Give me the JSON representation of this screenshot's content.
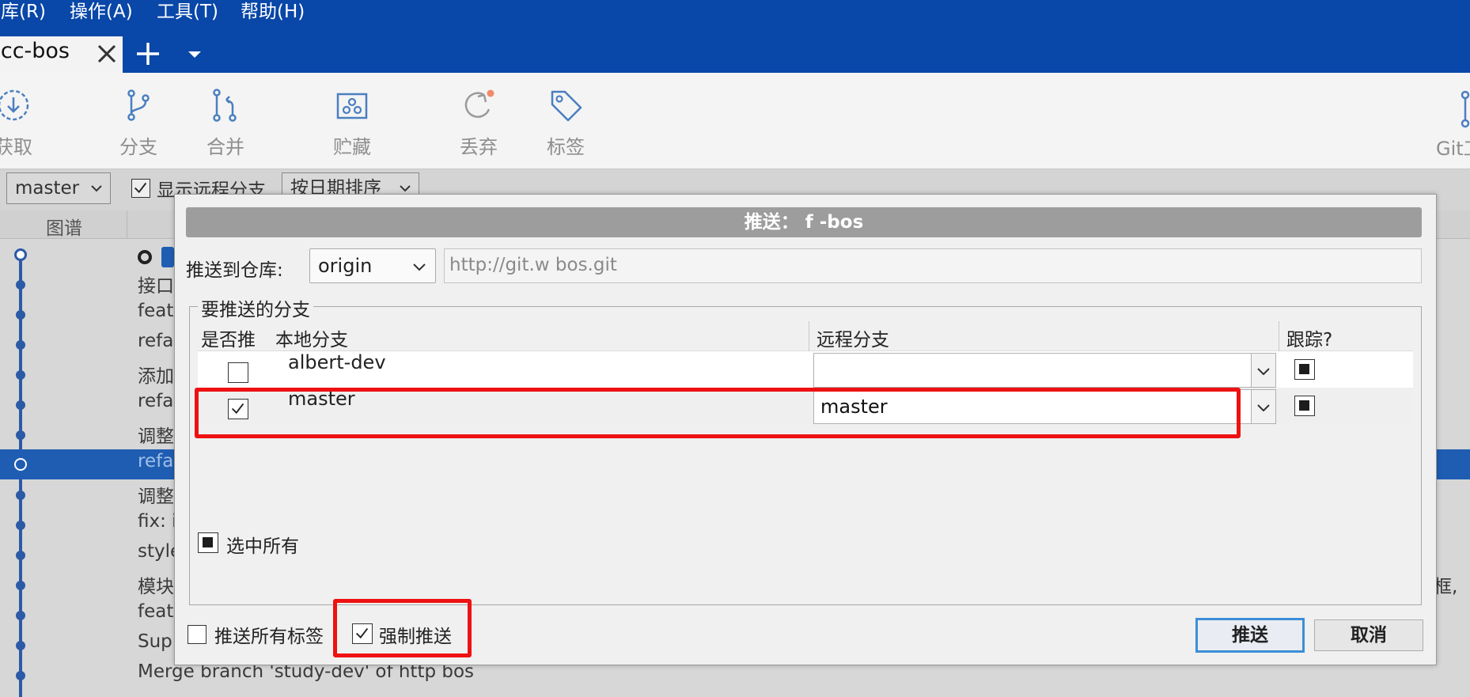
{
  "menubar": {
    "items": [
      {
        "label": "仓库(R)"
      },
      {
        "label": "操作(A)"
      },
      {
        "label": "工具(T)"
      },
      {
        "label": "帮助(H)"
      }
    ]
  },
  "tabs": {
    "active_label": "ccc-bos"
  },
  "toolbar": {
    "items": [
      {
        "label": "获取",
        "icon": "fetch-icon"
      },
      {
        "label": "分支",
        "icon": "branch-icon"
      },
      {
        "label": "合并",
        "icon": "merge-icon"
      },
      {
        "label": "贮藏",
        "icon": "stash-icon"
      },
      {
        "label": "丢弃",
        "icon": "discard-icon"
      },
      {
        "label": "标签",
        "icon": "tag-icon"
      }
    ],
    "right_label": "Git工"
  },
  "filters": {
    "branch_select": "master",
    "show_remote_label": "显示远程分支",
    "show_remote_checked": true,
    "sort_select": "按日期排序"
  },
  "history": {
    "graph_header": "图谱",
    "rows": [
      {
        "message": ""
      },
      {
        "message": "接口"
      },
      {
        "message": "feat"
      },
      {
        "message": "refa"
      },
      {
        "message": "添加"
      },
      {
        "message": "refa"
      },
      {
        "message": "调整"
      },
      {
        "message": "refa",
        "selected": true
      },
      {
        "message": "调整"
      },
      {
        "message": "fix: i"
      },
      {
        "message": "style"
      },
      {
        "message": "模块"
      },
      {
        "message": "feat"
      },
      {
        "message": "Sup"
      },
      {
        "message": "Merge branch 'study-dev' of http                              bos"
      }
    ],
    "right_edge_text": "框,"
  },
  "dialog": {
    "title": "推送： f           -bos",
    "push_to_label": "推送到仓库:",
    "remote": "origin",
    "remote_url": "http://git.w                                                    bos.git",
    "branches_group_label": "要推送的分支",
    "columns": {
      "push": "是否推",
      "local": "本地分支",
      "remote": "远程分支",
      "track": "跟踪?"
    },
    "branches": [
      {
        "local": "albert-dev",
        "remote": "",
        "push": false,
        "track": true
      },
      {
        "local": "master",
        "remote": "master",
        "push": true,
        "track": true
      }
    ],
    "select_all_label": "选中所有",
    "push_all_tags_label": "推送所有标签",
    "push_all_tags_checked": false,
    "force_push_label": "强制推送",
    "force_push_checked": true,
    "push_button": "推送",
    "cancel_button": "取消"
  },
  "annotation_color": "#ee1111",
  "accent_color": "#0947a8"
}
